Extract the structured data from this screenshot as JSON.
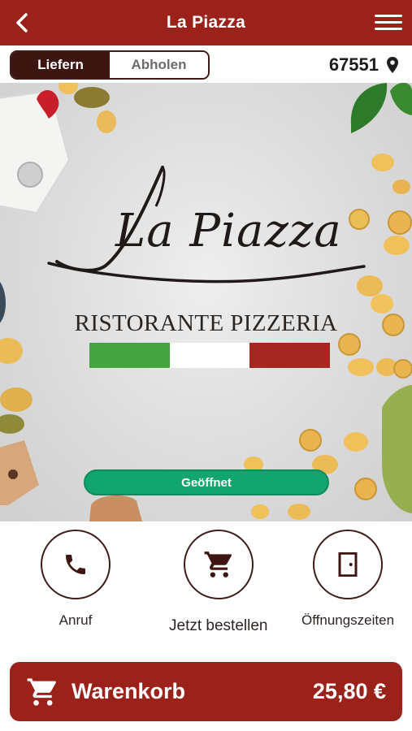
{
  "header": {
    "title": "La Piazza",
    "back_icon": "chevron-left-icon",
    "menu_icon": "hamburger-menu-icon",
    "color": "#9b221b"
  },
  "delivery_toggle": {
    "options": [
      {
        "label": "Liefern",
        "selected": true
      },
      {
        "label": "Abholen",
        "selected": false
      }
    ]
  },
  "location": {
    "postal_code": "67551",
    "icon": "map-pin-icon"
  },
  "hero": {
    "logo_script": "La Piazza",
    "logo_subtitle": "RISTORANTE PIZZERIA",
    "flag_colors": [
      "#44a540",
      "#ffffff",
      "#a52722"
    ],
    "status": "Geöffnet",
    "status_color": "#13a570"
  },
  "actions": [
    {
      "label": "Anruf",
      "icon": "phone-icon"
    },
    {
      "label": "Jetzt bestellen",
      "icon": "shopping-cart-icon"
    },
    {
      "label": "Öffnungszeiten",
      "icon": "door-icon"
    }
  ],
  "cart": {
    "label": "Warenkorb",
    "total": "25,80 €",
    "icon": "shopping-cart-icon"
  }
}
